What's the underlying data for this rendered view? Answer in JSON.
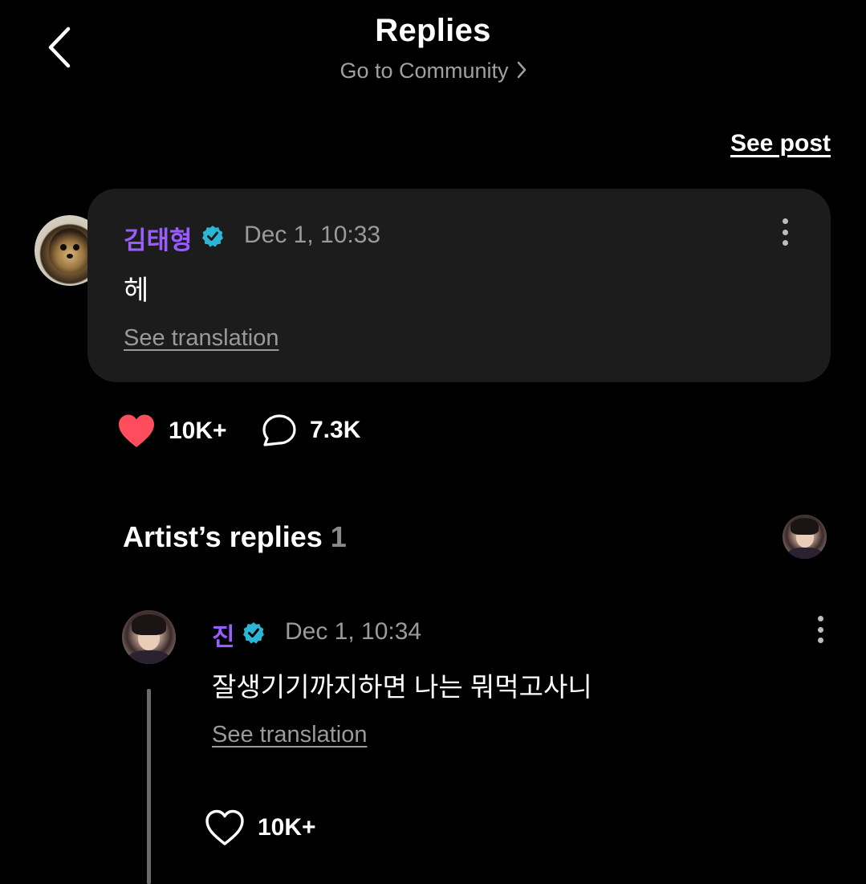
{
  "header": {
    "title": "Replies",
    "community_link": "Go to Community"
  },
  "see_post_label": "See post",
  "post": {
    "author": "김태형",
    "time": "Dec 1, 10:33",
    "body": "헤",
    "translation_label": "See translation",
    "likes": "10K+",
    "replies": "7.3K",
    "like_color": "#ff4d5e"
  },
  "artist_replies": {
    "title": "Artist’s replies",
    "count": "1",
    "items": [
      {
        "author": "진",
        "time": "Dec 1, 10:34",
        "body": "잘생기기까지하면 나는 뭐먹고사니",
        "translation_label": "See translation",
        "likes": "10K+"
      }
    ]
  },
  "colors": {
    "background": "#000000",
    "card": "#1c1c1c",
    "author_name": "#9b5cff",
    "verified_badge": "#2bb6d6",
    "muted_text": "#9a9a9a"
  },
  "icons": [
    "back-arrow-icon",
    "chevron-right-icon",
    "verified-badge-icon",
    "more-options-icon",
    "heart-filled-icon",
    "comment-bubble-icon",
    "heart-outline-icon"
  ]
}
